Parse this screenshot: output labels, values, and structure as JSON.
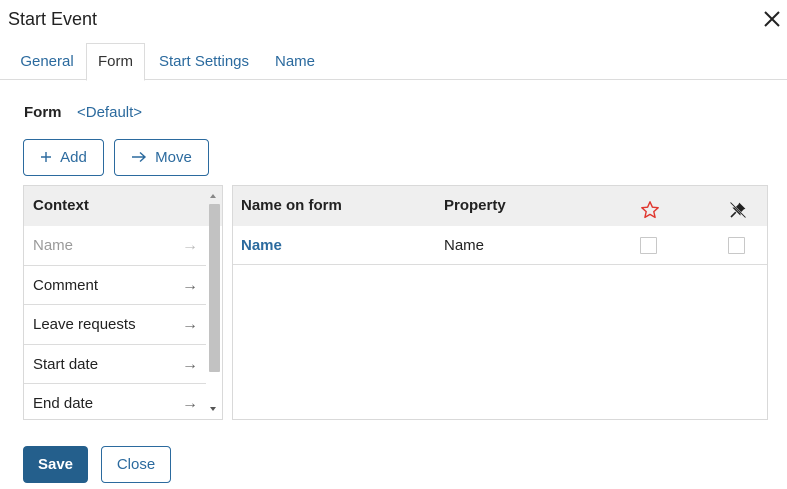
{
  "dialog": {
    "title": "Start Event",
    "tabs": [
      {
        "label": "General",
        "active": false
      },
      {
        "label": "Form",
        "active": true
      },
      {
        "label": "Start Settings",
        "active": false
      },
      {
        "label": "Name",
        "active": false
      }
    ]
  },
  "form": {
    "label": "Form",
    "value": "<Default>"
  },
  "toolbar": {
    "add_label": "Add",
    "add_icon": "plus-icon",
    "move_label": "Move",
    "move_icon": "arrow-right-icon"
  },
  "context": {
    "header": "Context",
    "items": [
      {
        "label": "Name",
        "disabled": true,
        "icon": "arrow-right-icon"
      },
      {
        "label": "Comment",
        "disabled": false,
        "icon": "arrow-right-icon"
      },
      {
        "label": "Leave requests",
        "disabled": false,
        "icon": "arrow-right-icon"
      },
      {
        "label": "Start date",
        "disabled": false,
        "icon": "arrow-right-icon"
      },
      {
        "label": "End date",
        "disabled": false,
        "icon": "arrow-right-icon"
      }
    ]
  },
  "grid": {
    "columns": {
      "name_on_form": "Name on form",
      "property": "Property",
      "required_icon": "star-icon",
      "readonly_icon": "pin-icon"
    },
    "rows": [
      {
        "name_on_form": "Name",
        "property": "Name",
        "required": false,
        "readonly": false
      }
    ]
  },
  "footer": {
    "save_label": "Save",
    "close_label": "Close"
  },
  "colors": {
    "accent": "#2b6a9e",
    "primary_button": "#245f8c",
    "star": "#e0362e",
    "header_bg": "#efefef"
  }
}
